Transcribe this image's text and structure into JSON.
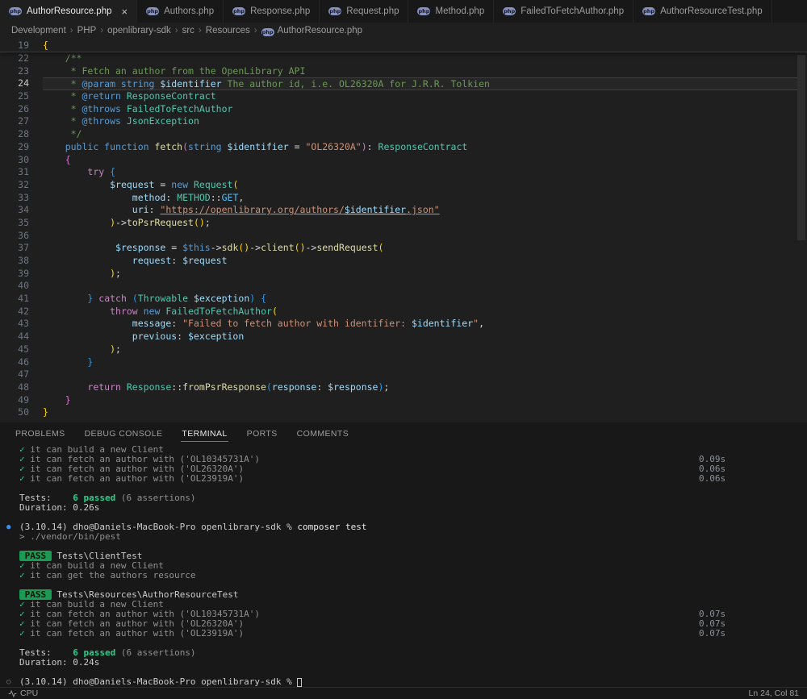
{
  "colors": {
    "accent_blue": "#2f86d1",
    "pass_green": "#23d18b",
    "badge_green": "#1c9a52",
    "php_icon_purple": "#8892BF",
    "editor_bg": "#1f1f1f",
    "panel_bg": "#181818"
  },
  "tab_bar": {
    "close_glyph": "×",
    "icon_text": "php",
    "tabs": [
      {
        "label": "AuthorResource.php",
        "active": true
      },
      {
        "label": "Authors.php",
        "active": false
      },
      {
        "label": "Response.php",
        "active": false
      },
      {
        "label": "Request.php",
        "active": false
      },
      {
        "label": "Method.php",
        "active": false
      },
      {
        "label": "FailedToFetchAuthor.php",
        "active": false
      },
      {
        "label": "AuthorResourceTest.php",
        "active": false
      }
    ]
  },
  "breadcrumb": {
    "separator": "›",
    "items": [
      "Development",
      "PHP",
      "openlibrary-sdk",
      "src",
      "Resources",
      "AuthorResource.php"
    ]
  },
  "editor": {
    "active_line": 24,
    "sticky_line": {
      "number": 19,
      "tokens": [
        [
          "b1",
          "{"
        ]
      ]
    },
    "lines": [
      {
        "number": 22,
        "tokens": [
          [
            "comment",
            "    /**"
          ]
        ]
      },
      {
        "number": 23,
        "tokens": [
          [
            "comment",
            "     * Fetch an author from the OpenLibrary API"
          ]
        ]
      },
      {
        "number": 24,
        "tokens": [
          [
            "comment",
            "     * "
          ],
          [
            "doctag",
            "@param string"
          ],
          [
            "comment",
            " "
          ],
          [
            "var",
            "$identifier"
          ],
          [
            "comment",
            " The author id, i.e. OL26320A for J.R.R. Tolkien"
          ]
        ]
      },
      {
        "number": 25,
        "tokens": [
          [
            "comment",
            "     * "
          ],
          [
            "doctag",
            "@return"
          ],
          [
            "comment",
            " "
          ],
          [
            "type",
            "ResponseContract"
          ]
        ]
      },
      {
        "number": 26,
        "tokens": [
          [
            "comment",
            "     * "
          ],
          [
            "doctag",
            "@throws"
          ],
          [
            "comment",
            " "
          ],
          [
            "type",
            "FailedToFetchAuthor"
          ]
        ]
      },
      {
        "number": 27,
        "tokens": [
          [
            "comment",
            "     * "
          ],
          [
            "doctag",
            "@throws"
          ],
          [
            "comment",
            " "
          ],
          [
            "type",
            "JsonException"
          ]
        ]
      },
      {
        "number": 28,
        "tokens": [
          [
            "comment",
            "     */"
          ]
        ]
      },
      {
        "number": 29,
        "tokens": [
          [
            "punct",
            "    "
          ],
          [
            "kw2",
            "public function "
          ],
          [
            "fn",
            "fetch"
          ],
          [
            "b2",
            "("
          ],
          [
            "kw2",
            "string"
          ],
          [
            "punct",
            " "
          ],
          [
            "var",
            "$identifier"
          ],
          [
            "punct",
            " = "
          ],
          [
            "str",
            "\"OL26320A\""
          ],
          [
            "b2",
            ")"
          ],
          [
            "punct",
            ": "
          ],
          [
            "type",
            "ResponseContract"
          ]
        ]
      },
      {
        "number": 30,
        "tokens": [
          [
            "punct",
            "    "
          ],
          [
            "b2",
            "{"
          ]
        ]
      },
      {
        "number": 31,
        "tokens": [
          [
            "punct",
            "        "
          ],
          [
            "kw",
            "try"
          ],
          [
            "punct",
            " "
          ],
          [
            "b3",
            "{"
          ]
        ]
      },
      {
        "number": 32,
        "tokens": [
          [
            "punct",
            "            "
          ],
          [
            "var",
            "$request"
          ],
          [
            "punct",
            " = "
          ],
          [
            "kw2",
            "new"
          ],
          [
            "punct",
            " "
          ],
          [
            "type",
            "Request"
          ],
          [
            "b1",
            "("
          ]
        ]
      },
      {
        "number": 33,
        "tokens": [
          [
            "punct",
            "                "
          ],
          [
            "var",
            "method"
          ],
          [
            "punct",
            ": "
          ],
          [
            "type",
            "METHOD"
          ],
          [
            "punct",
            "::"
          ],
          [
            "const",
            "GET"
          ],
          [
            "punct",
            ","
          ]
        ]
      },
      {
        "number": 34,
        "tokens": [
          [
            "punct",
            "                "
          ],
          [
            "var",
            "uri"
          ],
          [
            "punct",
            ": "
          ],
          [
            "strlink",
            "\"https://openlibrary.org/authors/"
          ],
          [
            "varlink",
            "$identifier"
          ],
          [
            "strlink",
            ".json\""
          ]
        ]
      },
      {
        "number": 35,
        "tokens": [
          [
            "punct",
            "            "
          ],
          [
            "b1",
            ")"
          ],
          [
            "punct",
            "->"
          ],
          [
            "fn",
            "toPsrRequest"
          ],
          [
            "b1",
            "()"
          ],
          [
            "punct",
            ";"
          ]
        ]
      },
      {
        "number": 36,
        "tokens": []
      },
      {
        "number": 37,
        "tokens": [
          [
            "punct",
            "             "
          ],
          [
            "var",
            "$response"
          ],
          [
            "punct",
            " = "
          ],
          [
            "kw2",
            "$this"
          ],
          [
            "punct",
            "->"
          ],
          [
            "fn",
            "sdk"
          ],
          [
            "b1",
            "()"
          ],
          [
            "punct",
            "->"
          ],
          [
            "fn",
            "client"
          ],
          [
            "b1",
            "()"
          ],
          [
            "punct",
            "->"
          ],
          [
            "fn",
            "sendRequest"
          ],
          [
            "b1",
            "("
          ]
        ]
      },
      {
        "number": 38,
        "tokens": [
          [
            "punct",
            "                "
          ],
          [
            "var",
            "request"
          ],
          [
            "punct",
            ": "
          ],
          [
            "var",
            "$request"
          ]
        ]
      },
      {
        "number": 39,
        "tokens": [
          [
            "punct",
            "            "
          ],
          [
            "b1",
            ")"
          ],
          [
            "punct",
            ";"
          ]
        ]
      },
      {
        "number": 40,
        "tokens": []
      },
      {
        "number": 41,
        "tokens": [
          [
            "punct",
            "        "
          ],
          [
            "b3",
            "}"
          ],
          [
            "punct",
            " "
          ],
          [
            "kw",
            "catch"
          ],
          [
            "punct",
            " "
          ],
          [
            "b3",
            "("
          ],
          [
            "type",
            "Throwable"
          ],
          [
            "punct",
            " "
          ],
          [
            "var",
            "$exception"
          ],
          [
            "b3",
            ")"
          ],
          [
            "punct",
            " "
          ],
          [
            "b3",
            "{"
          ]
        ]
      },
      {
        "number": 42,
        "tokens": [
          [
            "punct",
            "            "
          ],
          [
            "kw",
            "throw"
          ],
          [
            "punct",
            " "
          ],
          [
            "kw2",
            "new"
          ],
          [
            "punct",
            " "
          ],
          [
            "type",
            "FailedToFetchAuthor"
          ],
          [
            "b1",
            "("
          ]
        ]
      },
      {
        "number": 43,
        "tokens": [
          [
            "punct",
            "                "
          ],
          [
            "var",
            "message"
          ],
          [
            "punct",
            ": "
          ],
          [
            "str",
            "\"Failed to fetch author with identifier: "
          ],
          [
            "var",
            "$identifier"
          ],
          [
            "str",
            "\""
          ],
          [
            "punct",
            ","
          ]
        ]
      },
      {
        "number": 44,
        "tokens": [
          [
            "punct",
            "                "
          ],
          [
            "var",
            "previous"
          ],
          [
            "punct",
            ": "
          ],
          [
            "var",
            "$exception"
          ]
        ]
      },
      {
        "number": 45,
        "tokens": [
          [
            "punct",
            "            "
          ],
          [
            "b1",
            ")"
          ],
          [
            "punct",
            ";"
          ]
        ]
      },
      {
        "number": 46,
        "tokens": [
          [
            "punct",
            "        "
          ],
          [
            "b3",
            "}"
          ]
        ]
      },
      {
        "number": 47,
        "tokens": []
      },
      {
        "number": 48,
        "tokens": [
          [
            "punct",
            "        "
          ],
          [
            "kw",
            "return"
          ],
          [
            "punct",
            " "
          ],
          [
            "type",
            "Response"
          ],
          [
            "punct",
            "::"
          ],
          [
            "fn",
            "fromPsrResponse"
          ],
          [
            "b3",
            "("
          ],
          [
            "var",
            "response"
          ],
          [
            "punct",
            ": "
          ],
          [
            "var",
            "$response"
          ],
          [
            "b3",
            ")"
          ],
          [
            "punct",
            ";"
          ]
        ]
      },
      {
        "number": 49,
        "tokens": [
          [
            "punct",
            "    "
          ],
          [
            "b2",
            "}"
          ]
        ]
      },
      {
        "number": 50,
        "tokens": [
          [
            "b1",
            "}"
          ]
        ]
      }
    ]
  },
  "panel": {
    "tabs": [
      {
        "label": "PROBLEMS",
        "active": false
      },
      {
        "label": "DEBUG CONSOLE",
        "active": false
      },
      {
        "label": "TERMINAL",
        "active": true
      },
      {
        "label": "PORTS",
        "active": false
      },
      {
        "label": "COMMENTS",
        "active": false
      }
    ]
  },
  "terminal": {
    "glyphs": {
      "run": "●",
      "idle": "○"
    },
    "lines": [
      {
        "seg": [
          [
            "chk",
            "✓ "
          ],
          [
            "dim",
            "it can build a new Client"
          ]
        ]
      },
      {
        "seg": [
          [
            "chk",
            "✓ "
          ],
          [
            "dim",
            "it can fetch an author with ('OL10345731A')"
          ]
        ],
        "right": "0.09s"
      },
      {
        "seg": [
          [
            "chk",
            "✓ "
          ],
          [
            "dim",
            "it can fetch an author with ('OL26320A')"
          ]
        ],
        "right": "0.06s"
      },
      {
        "seg": [
          [
            "chk",
            "✓ "
          ],
          [
            "dim",
            "it can fetch an author with ('OL23919A')"
          ]
        ],
        "right": "0.06s"
      },
      {
        "seg": []
      },
      {
        "seg": [
          [
            "fg",
            "Tests:    "
          ],
          [
            "grn",
            "6 passed"
          ],
          [
            "dim",
            " (6 assertions)"
          ]
        ]
      },
      {
        "seg": [
          [
            "fg",
            "Duration: 0.26s"
          ]
        ]
      },
      {
        "seg": []
      },
      {
        "m": "run",
        "seg": [
          [
            "fg",
            "(3.10.14) dho@Daniels-MacBook-Pro openlibrary-sdk % "
          ],
          [
            "cmd",
            "composer test"
          ]
        ]
      },
      {
        "seg": [
          [
            "dim",
            "> ./vendor/bin/pest"
          ]
        ]
      },
      {
        "seg": []
      },
      {
        "seg": [
          [
            "badge",
            " PASS "
          ],
          [
            "fg",
            " Tests\\ClientTest"
          ]
        ]
      },
      {
        "seg": [
          [
            "chk",
            "✓ "
          ],
          [
            "dim",
            "it can build a new Client"
          ]
        ]
      },
      {
        "seg": [
          [
            "chk",
            "✓ "
          ],
          [
            "dim",
            "it can get the authors resource"
          ]
        ]
      },
      {
        "seg": []
      },
      {
        "seg": [
          [
            "badge",
            " PASS "
          ],
          [
            "fg",
            " Tests\\Resources\\AuthorResourceTest"
          ]
        ]
      },
      {
        "seg": [
          [
            "chk",
            "✓ "
          ],
          [
            "dim",
            "it can build a new Client"
          ]
        ]
      },
      {
        "seg": [
          [
            "chk",
            "✓ "
          ],
          [
            "dim",
            "it can fetch an author with ('OL10345731A')"
          ]
        ],
        "right": "0.07s"
      },
      {
        "seg": [
          [
            "chk",
            "✓ "
          ],
          [
            "dim",
            "it can fetch an author with ('OL26320A')"
          ]
        ],
        "right": "0.07s"
      },
      {
        "seg": [
          [
            "chk",
            "✓ "
          ],
          [
            "dim",
            "it can fetch an author with ('OL23919A')"
          ]
        ],
        "right": "0.07s"
      },
      {
        "seg": []
      },
      {
        "seg": [
          [
            "fg",
            "Tests:    "
          ],
          [
            "grn",
            "6 passed"
          ],
          [
            "dim",
            " (6 assertions)"
          ]
        ]
      },
      {
        "seg": [
          [
            "fg",
            "Duration: 0.24s"
          ]
        ]
      },
      {
        "seg": []
      },
      {
        "m": "idle",
        "seg": [
          [
            "fg",
            "(3.10.14) dho@Daniels-MacBook-Pro openlibrary-sdk % "
          ],
          [
            "cursor",
            ""
          ]
        ]
      }
    ]
  },
  "status_bar": {
    "cpu_label": "CPU",
    "cursor_position": "Ln 24, Col 81"
  }
}
